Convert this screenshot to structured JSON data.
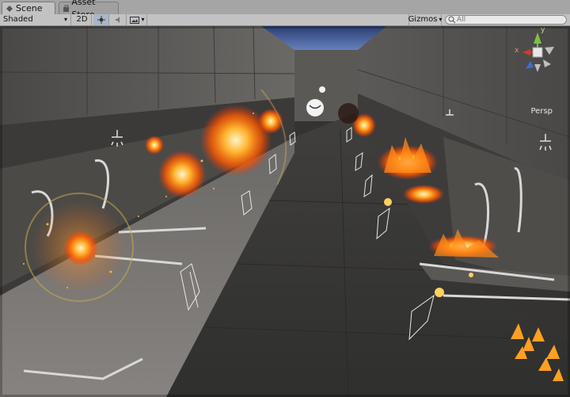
{
  "tabs": [
    {
      "label": "Scene",
      "icon": "scene-icon"
    },
    {
      "label": "Asset Store",
      "icon": "asset-store-icon"
    }
  ],
  "toolbar": {
    "shading_mode": "Shaded",
    "mode_2d": "2D",
    "gizmos_label": "Gizmos",
    "search_placeholder": "All"
  },
  "gizmo": {
    "axis_y": "y",
    "axis_x": "x",
    "projection": "Persp"
  }
}
